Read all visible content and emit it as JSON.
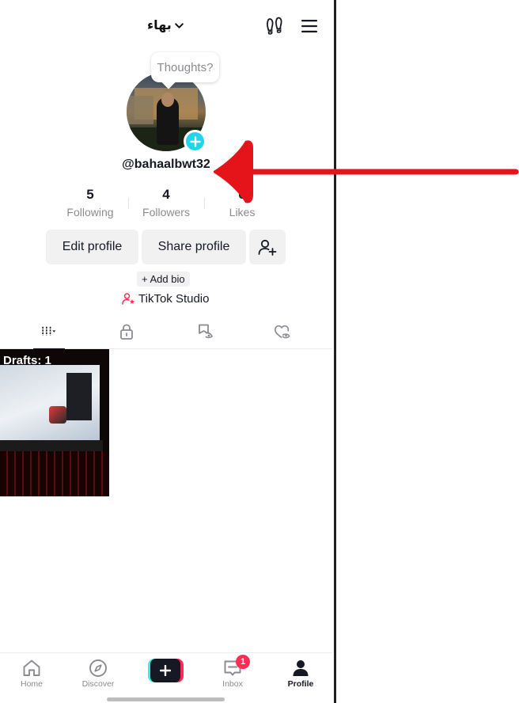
{
  "header": {
    "username": "بهاء",
    "dropdown_icon": "chevron-down-icon",
    "footprint_icon": "footprint-icon",
    "menu_icon": "menu-icon"
  },
  "profile": {
    "thoughts_placeholder": "Thoughts?",
    "handle": "@bahaalbwt32",
    "stats": [
      {
        "value": "5",
        "label": "Following"
      },
      {
        "value": "4",
        "label": "Followers"
      },
      {
        "value": "0",
        "label": "Likes"
      }
    ],
    "edit_profile_label": "Edit profile",
    "share_profile_label": "Share profile",
    "add_bio_label": "+ Add bio",
    "studio_label": "TikTok Studio"
  },
  "tabs": [
    {
      "name": "videos",
      "icon": "grid-icon",
      "active": true
    },
    {
      "name": "private",
      "icon": "lock-icon",
      "active": false
    },
    {
      "name": "favorites",
      "icon": "bookmark-icon",
      "active": false
    },
    {
      "name": "liked",
      "icon": "heart-icon",
      "active": false
    }
  ],
  "drafts": {
    "label": "Drafts: 1"
  },
  "bottom_nav": {
    "home_label": "Home",
    "discover_label": "Discover",
    "inbox_label": "Inbox",
    "inbox_badge": "1",
    "profile_label": "Profile"
  },
  "colors": {
    "accent_cyan": "#20d5ec",
    "accent_red": "#fe2c55",
    "annotation_arrow": "#e5141b"
  }
}
